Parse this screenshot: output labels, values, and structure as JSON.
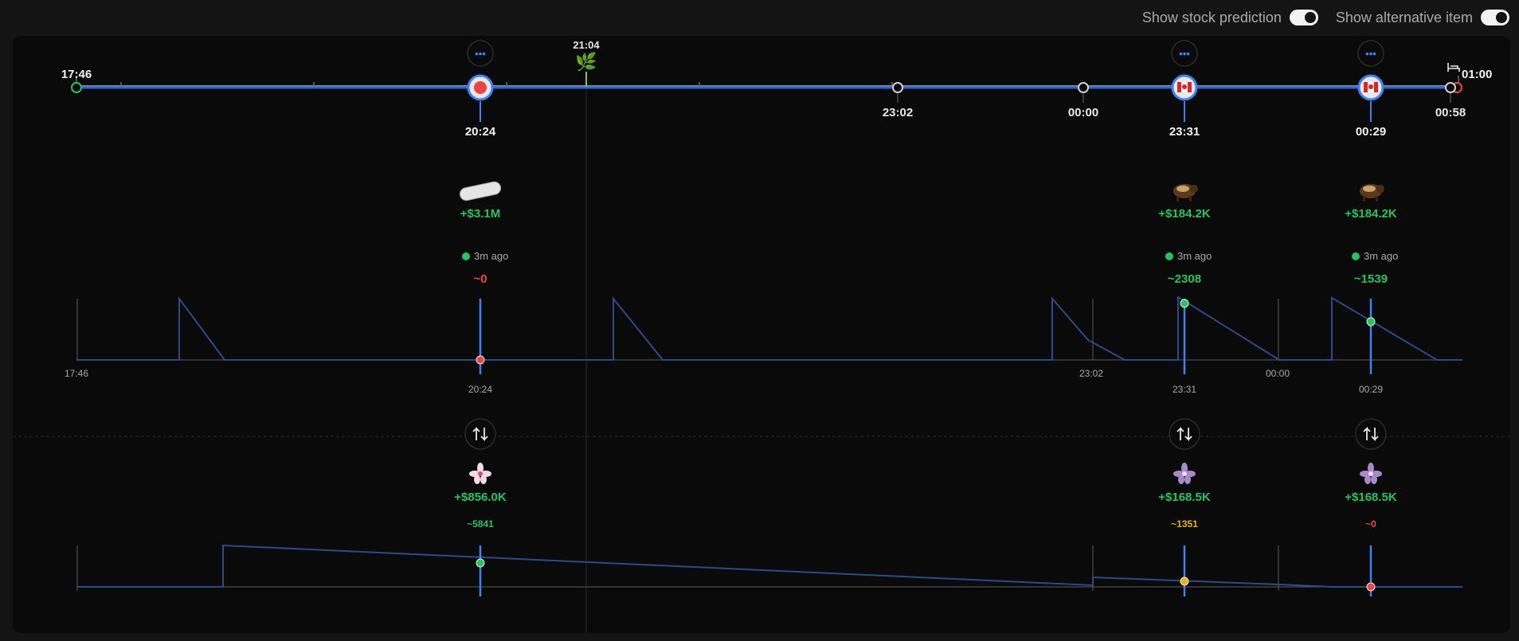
{
  "toggles": {
    "stock_prediction_label": "Show stock prediction",
    "alternative_item_label": "Show alternative item"
  },
  "timeline": {
    "start_time": "17:46",
    "marker_time": "21:04",
    "marker_icon": "🌿",
    "end_time": "01:00",
    "end_icon": "bed-icon",
    "more_label": "•••",
    "checkpoints": [
      {
        "time": "23:02"
      },
      {
        "time": "00:00"
      },
      {
        "time": "00:58"
      }
    ],
    "events": [
      {
        "time": "20:24",
        "badge": "red-circle",
        "item_icon": "pill-icon",
        "value": "+$3.1M",
        "ago": "3m ago",
        "stock": "~0",
        "stock_color": "#ef4444",
        "stock_dot_color": "#ef4444",
        "chart_time": "20:24",
        "alt_icon": "flower-icon",
        "alt_value": "+$856.0K",
        "alt_stock": "~5841",
        "alt_stock_color": "#22c55e",
        "alt_dot_color": "#22c55e"
      },
      {
        "time": "23:31",
        "badge": "canada-flag",
        "item_icon": "wolverine-icon",
        "value": "+$184.2K",
        "ago": "3m ago",
        "stock": "~2308",
        "stock_color": "#22c55e",
        "stock_dot_color": "#22c55e",
        "chart_time": "23:31",
        "alt_icon": "flower-icon",
        "alt_value": "+$168.5K",
        "alt_stock": "~1351",
        "alt_stock_color": "#eab308",
        "alt_dot_color": "#eab308"
      },
      {
        "time": "00:29",
        "badge": "canada-flag",
        "item_icon": "wolverine-icon",
        "value": "+$184.2K",
        "ago": "3m ago",
        "stock": "~1539",
        "stock_color": "#22c55e",
        "stock_dot_color": "#22c55e",
        "chart_time": "00:29",
        "alt_icon": "flower-icon",
        "alt_value": "+$168.5K",
        "alt_stock": "~0",
        "alt_stock_color": "#ef4444",
        "alt_dot_color": "#ef4444"
      }
    ],
    "chart_axis_labels": [
      "17:46",
      "23:02",
      "00:00"
    ]
  },
  "colors": {
    "accent_blue": "#3b82f6",
    "green": "#22c55e",
    "red": "#ef4444",
    "yellow": "#eab308"
  }
}
